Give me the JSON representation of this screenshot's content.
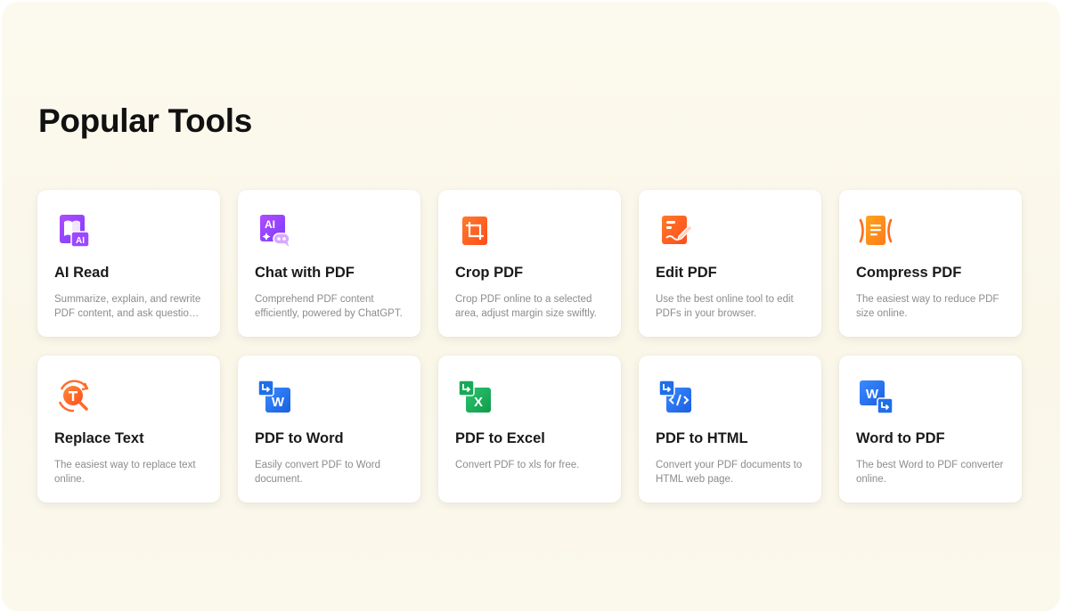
{
  "section": {
    "title": "Popular Tools"
  },
  "tools": [
    {
      "title": "AI Read",
      "desc": "Summarize, explain, and rewrite PDF content, and ask questions about it.",
      "icon": "ai-read-icon"
    },
    {
      "title": "Chat with PDF",
      "desc": "Comprehend PDF content efficiently, powered by ChatGPT.",
      "icon": "chat-ai-icon"
    },
    {
      "title": "Crop PDF",
      "desc": "Crop PDF online to a selected area, adjust margin size swiftly.",
      "icon": "crop-icon"
    },
    {
      "title": "Edit PDF",
      "desc": "Use the best online tool to edit PDFs in your browser.",
      "icon": "edit-icon"
    },
    {
      "title": "Compress PDF",
      "desc": "The easiest way to reduce PDF size online.",
      "icon": "compress-icon"
    },
    {
      "title": "Replace Text",
      "desc": "The easiest way to replace text online.",
      "icon": "replace-text-icon"
    },
    {
      "title": "PDF to Word",
      "desc": "Easily convert PDF to Word document.",
      "icon": "pdf-to-word-icon"
    },
    {
      "title": "PDF to Excel",
      "desc": "Convert PDF to xls for free.",
      "icon": "pdf-to-excel-icon"
    },
    {
      "title": "PDF to HTML",
      "desc": "Convert your PDF documents to HTML web page.",
      "icon": "pdf-to-html-icon"
    },
    {
      "title": "Word to PDF",
      "desc": "The best Word to PDF converter online.",
      "icon": "word-to-pdf-icon"
    }
  ],
  "colors": {
    "ai_purple": "#8b3dff",
    "pdf_orange": "#ff5a1f",
    "word_blue": "#1f6fe8",
    "excel_green": "#17a957"
  }
}
